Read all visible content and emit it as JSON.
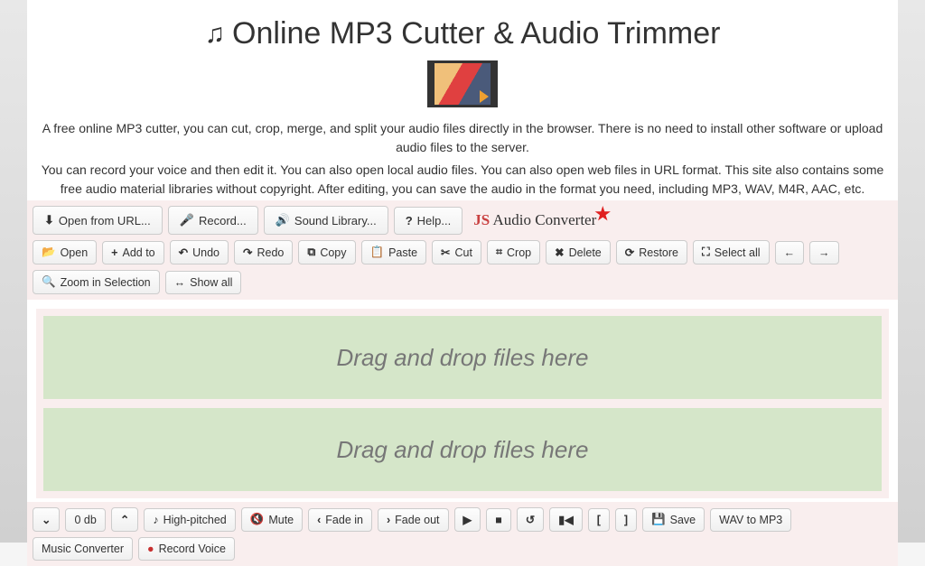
{
  "header": {
    "title": "Online MP3 Cutter & Audio Trimmer"
  },
  "description": {
    "line1": "A free online MP3 cutter, you can cut, crop, merge, and split your audio files directly in the browser. There is no need to install other software or upload audio files to the server.",
    "line2": "You can record your voice and then edit it. You can also open local audio files. You can also open web files in URL format. This site also contains some free audio material libraries without copyright. After editing, you can save the audio in the format you need, including MP3, WAV, M4R, AAC, etc."
  },
  "primaryToolbar": {
    "open_url": "Open from URL...",
    "record": "Record...",
    "sound_library": "Sound Library...",
    "help": "Help...",
    "converter_js": "JS",
    "converter_label": " Audio Converter"
  },
  "editToolbar": {
    "open": "Open",
    "add_to": "Add to",
    "undo": "Undo",
    "redo": "Redo",
    "copy": "Copy",
    "paste": "Paste",
    "cut": "Cut",
    "crop": "Crop",
    "delete": "Delete",
    "restore": "Restore",
    "select_all": "Select all",
    "zoom_selection": "Zoom in Selection",
    "show_all": "Show all"
  },
  "dropZones": {
    "zone1": "Drag and drop files here",
    "zone2": "Drag and drop files here"
  },
  "bottomBar": {
    "db": "0 db",
    "high_pitched": "High-pitched",
    "mute": "Mute",
    "fade_in": "Fade in",
    "fade_out": "Fade out",
    "save": "Save",
    "wav_to_mp3": "WAV to MP3",
    "music_converter": "Music Converter",
    "record_voice": "Record Voice"
  }
}
